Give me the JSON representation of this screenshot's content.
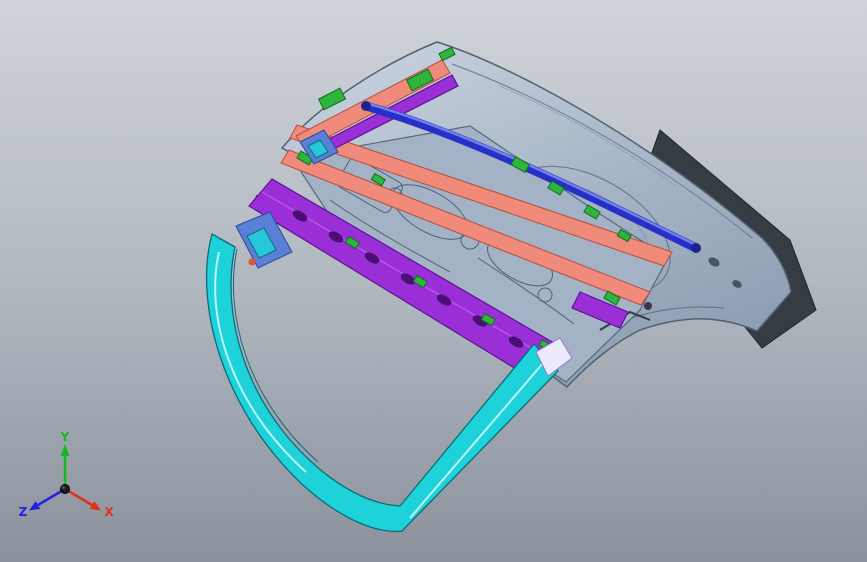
{
  "viewport": {
    "background_top": "#cfd4da",
    "background_mid": "#b2b8c0",
    "background_bottom": "#8c929c"
  },
  "axis_triad": {
    "x_label": "X",
    "y_label": "Y",
    "z_label": "Z",
    "x_color": "#e03020",
    "y_color": "#16b81e",
    "z_color": "#2024dc"
  },
  "parts": {
    "outer_panel_shadow": "#363c44",
    "inner_panel": "#a3b3c5",
    "torsion_tube": "#2531c6",
    "rail_salmon": "#f08a7a",
    "rail_purple": "#9a2fd8",
    "frame_cyan": "#1ed2da",
    "clip_green": "#2fb53c",
    "hinge_blue": "#5a7fd6",
    "hinge_cyan": "#27c6d8",
    "bracket_white": "#eceafb"
  }
}
